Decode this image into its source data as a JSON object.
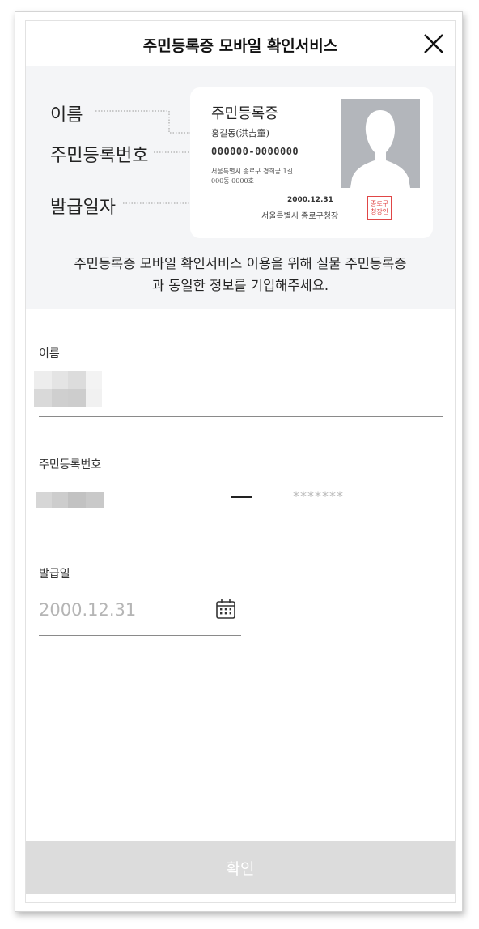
{
  "header": {
    "title": "주민등록증 모바일 확인서비스",
    "close_icon": "close-icon"
  },
  "guide": {
    "labels": {
      "name": "이름",
      "id_number": "주민등록번호",
      "issue_date": "발급일자"
    },
    "card": {
      "title": "주민등록증",
      "name": "홍길동(洪吉童)",
      "id_number": "000000-0000000",
      "address_line1": "서울특별시 종로구 경희궁 1길",
      "address_line2": "000동 0000호",
      "issue_date": "2000.12.31",
      "issuer": "서울특별시 종로구청장",
      "seal_line1": "종로구",
      "seal_line2": "청장인"
    },
    "description_line1": "주민등록증 모바일 확인서비스 이용을 위해 실물 주민등록증",
    "description_line2": "과 동일한 정보를 기입해주세요."
  },
  "form": {
    "name_label": "이름",
    "id_label": "주민등록번호",
    "id_back_placeholder": "*******",
    "issue_label": "발급일",
    "issue_value": "2000.12.31",
    "calendar_icon": "calendar-icon"
  },
  "confirm_label": "확인",
  "colors": {
    "accent_seal": "#e04646",
    "intro_bg": "#f4f5f7",
    "button_disabled": "#dcdcdc"
  }
}
